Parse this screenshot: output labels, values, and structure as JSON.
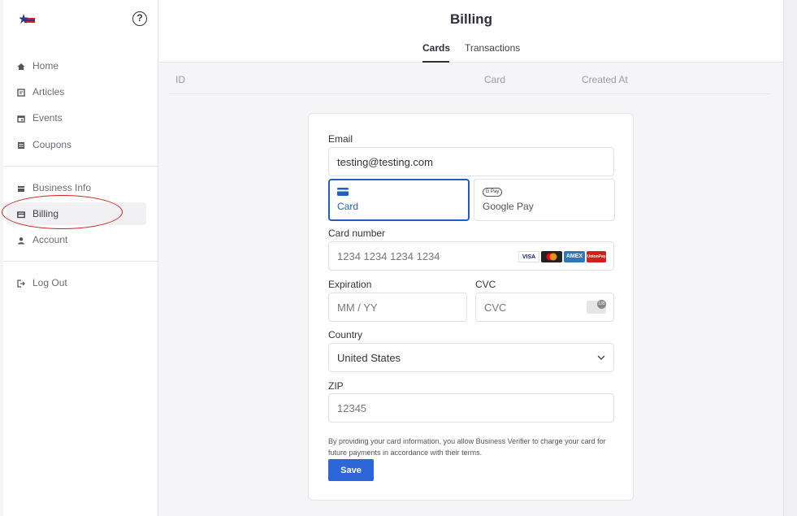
{
  "sidebar": {
    "items": [
      {
        "label": "Home",
        "icon": "home-icon"
      },
      {
        "label": "Articles",
        "icon": "articles-icon"
      },
      {
        "label": "Events",
        "icon": "events-icon"
      },
      {
        "label": "Coupons",
        "icon": "coupons-icon"
      },
      {
        "label": "Business Info",
        "icon": "business-info-icon"
      },
      {
        "label": "Billing",
        "icon": "billing-icon",
        "active": true
      },
      {
        "label": "Account",
        "icon": "account-icon"
      },
      {
        "label": "Log Out",
        "icon": "logout-icon"
      }
    ],
    "help_glyph": "?"
  },
  "header": {
    "title": "Billing",
    "tabs": [
      {
        "label": "Cards",
        "active": true
      },
      {
        "label": "Transactions"
      }
    ]
  },
  "table": {
    "columns": [
      "ID",
      "Card",
      "Created At"
    ]
  },
  "form": {
    "email_label": "Email",
    "email_value": "testing@testing.com",
    "methods": [
      {
        "label": "Card",
        "active": true
      },
      {
        "label": "Google Pay",
        "badge": "G Pay"
      }
    ],
    "card_number_label": "Card number",
    "card_number_placeholder": "1234 1234 1234 1234",
    "card_brands": [
      "VISA",
      "",
      "AMEX",
      "UnionPay"
    ],
    "expiration_label": "Expiration",
    "expiration_placeholder": "MM / YY",
    "cvc_label": "CVC",
    "cvc_placeholder": "CVC",
    "cvc_badge": "135",
    "country_label": "Country",
    "country_value": "United States",
    "zip_label": "ZIP",
    "zip_placeholder": "12345",
    "disclaimer": "By providing your card information, you allow Business Verifier to charge your card for future payments in accordance with their terms.",
    "save_label": "Save"
  },
  "colors": {
    "accent": "#2c66d8",
    "active_border": "#1f5fbf",
    "annotation": "#d2201a"
  }
}
